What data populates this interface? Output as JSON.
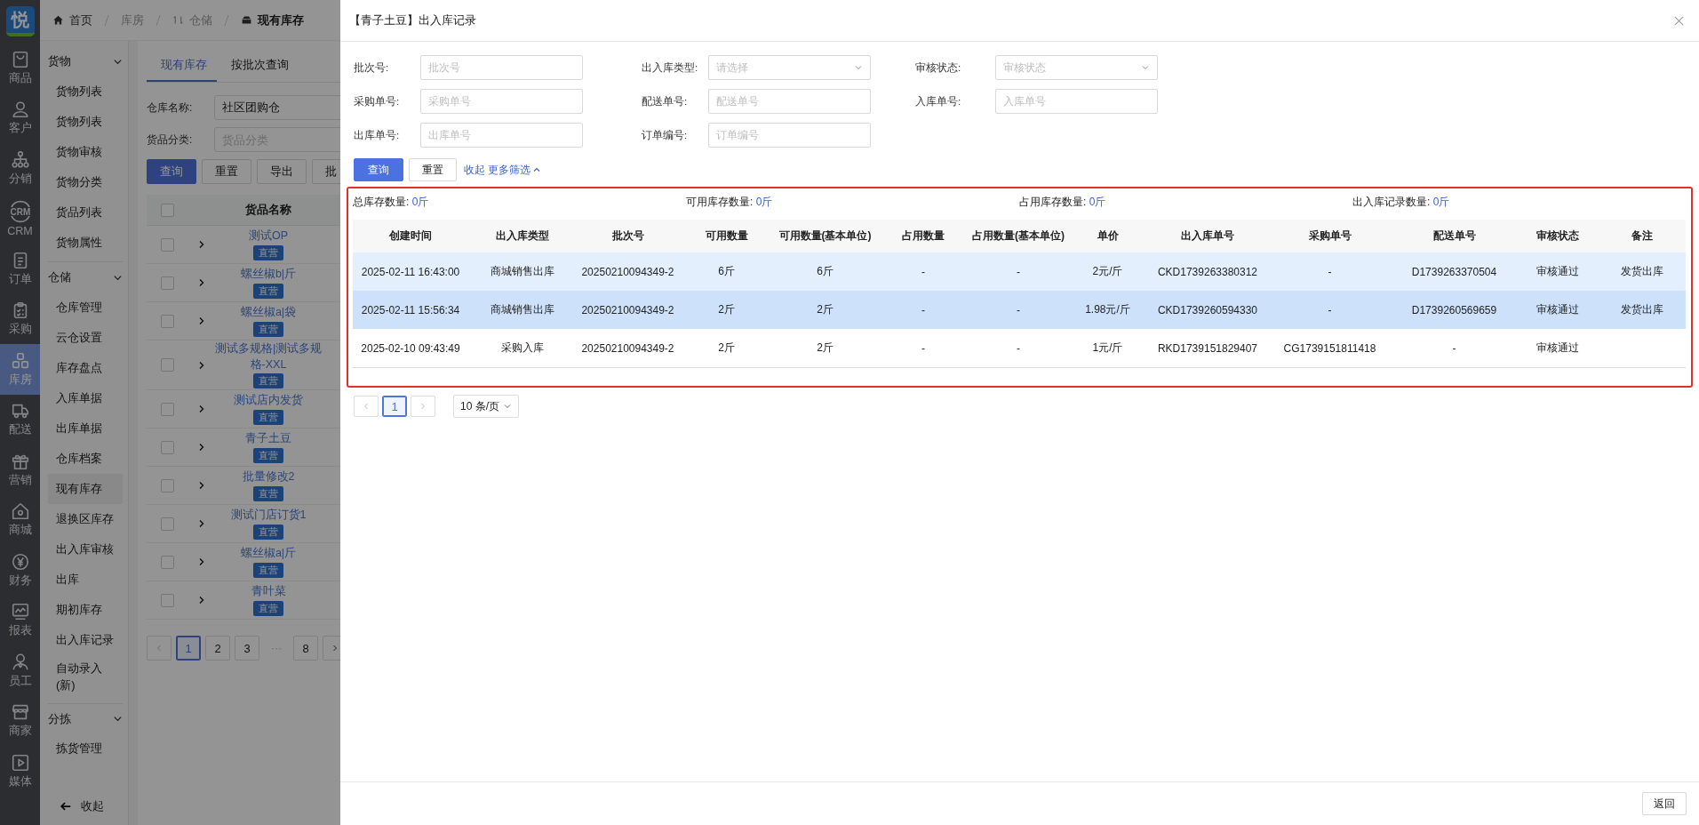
{
  "app": {
    "logo": "悦"
  },
  "nav_rail": [
    {
      "label": "商品",
      "selected": false
    },
    {
      "label": "客户",
      "selected": false
    },
    {
      "label": "分销",
      "selected": false
    },
    {
      "label": "CRM",
      "icon_text": "CRM",
      "selected": false
    },
    {
      "label": "订单",
      "selected": false
    },
    {
      "label": "采购",
      "selected": false
    },
    {
      "label": "库房",
      "selected": true
    },
    {
      "label": "配送",
      "selected": false
    },
    {
      "label": "营销",
      "selected": false
    },
    {
      "label": "商城",
      "selected": false
    },
    {
      "label": "财务",
      "selected": false
    },
    {
      "label": "报表",
      "selected": false
    },
    {
      "label": "员工",
      "selected": false
    },
    {
      "label": "商家",
      "selected": false
    },
    {
      "label": "媒体",
      "selected": false
    }
  ],
  "breadcrumb": [
    {
      "label": "首页",
      "current": false
    },
    {
      "label": "库房",
      "current": false
    },
    {
      "label": "仓储",
      "current": false
    },
    {
      "label": "现有库存",
      "current": true
    }
  ],
  "submenu": [
    {
      "label": "货物",
      "expanded": true,
      "children": [
        {
          "label": "货物列表",
          "selected": false
        },
        {
          "label": "货物列表",
          "selected": false
        },
        {
          "label": "货物审核",
          "selected": false
        },
        {
          "label": "货物分类",
          "selected": false
        },
        {
          "label": "货品列表",
          "selected": false
        },
        {
          "label": "货物属性",
          "selected": false
        }
      ]
    },
    {
      "label": "仓储",
      "expanded": true,
      "children": [
        {
          "label": "仓库管理",
          "selected": false
        },
        {
          "label": "云仓设置",
          "selected": false
        },
        {
          "label": "库存盘点",
          "selected": false
        },
        {
          "label": "入库单据",
          "selected": false
        },
        {
          "label": "出库单据",
          "selected": false
        },
        {
          "label": "仓库档案",
          "selected": false
        },
        {
          "label": "现有库存",
          "selected": true
        },
        {
          "label": "退换区库存",
          "selected": false
        },
        {
          "label": "出入库审核",
          "selected": false
        },
        {
          "label": "出库",
          "selected": false
        },
        {
          "label": "期初库存",
          "selected": false
        },
        {
          "label": "出入库记录",
          "selected": false
        },
        {
          "label": "自动录入(新)",
          "selected": false
        }
      ]
    },
    {
      "label": "分拣",
      "expanded": true,
      "children": [
        {
          "label": "拣货管理",
          "selected": false
        }
      ]
    }
  ],
  "collapse": "收起",
  "page": {
    "tabs": [
      {
        "label": "现有库存",
        "selected": true
      },
      {
        "label": "按批次查询",
        "selected": false
      }
    ],
    "filters": [
      {
        "label": "仓库名称:",
        "value": "社区团购仓"
      },
      {
        "label": "货品分类:",
        "placeholder": "货品分类"
      }
    ],
    "buttons": [
      {
        "label": "查询",
        "kind": "primary"
      },
      {
        "label": "重置",
        "kind": "default"
      },
      {
        "label": "导出",
        "kind": "default"
      },
      {
        "label": "批",
        "kind": "default"
      }
    ],
    "table": {
      "column": "货品名称",
      "all_checked": false,
      "rows": [
        {
          "name": "测试OP",
          "tag": "直营",
          "checked": false
        },
        {
          "name": "螺丝椒b|斤",
          "tag": "直营",
          "checked": false
        },
        {
          "name": "螺丝椒a|袋",
          "tag": "直营",
          "checked": false
        },
        {
          "name": "测试多规格|测试多规格-XXL",
          "tag": "直营",
          "checked": false
        },
        {
          "name": "测试店内发货",
          "tag": "直营",
          "checked": false
        },
        {
          "name": "青子土豆",
          "tag": "直营",
          "checked": false
        },
        {
          "name": "批量修改2",
          "tag": "直营",
          "checked": false
        },
        {
          "name": "测试门店订货1",
          "tag": "直营",
          "checked": false
        },
        {
          "name": "螺丝椒a|斤",
          "tag": "直营",
          "checked": false
        },
        {
          "name": "青叶菜",
          "tag": "直营",
          "checked": false
        }
      ]
    },
    "pagination": [
      {
        "label": "1",
        "kind": "page",
        "selected": true
      },
      {
        "label": "2",
        "kind": "page",
        "selected": false
      },
      {
        "label": "3",
        "kind": "page",
        "selected": false
      },
      {
        "label": "···",
        "kind": "ellipsis"
      },
      {
        "label": "8",
        "kind": "page",
        "selected": false
      }
    ]
  },
  "dialog": {
    "title": "【青子土豆】出入库记录",
    "filters": [
      {
        "label": "批次号:",
        "placeholder": "批次号",
        "kind": "input"
      },
      {
        "label": "出入库类型:",
        "placeholder": "请选择",
        "kind": "select"
      },
      {
        "label": "审核状态:",
        "placeholder": "审核状态",
        "kind": "select"
      },
      {
        "label": "采购单号:",
        "placeholder": "采购单号",
        "kind": "input"
      },
      {
        "label": "配送单号:",
        "placeholder": "配送单号",
        "kind": "input"
      },
      {
        "label": "入库单号:",
        "placeholder": "入库单号",
        "kind": "input"
      },
      {
        "label": "出库单号:",
        "placeholder": "出库单号",
        "kind": "input"
      },
      {
        "label": "订单编号:",
        "placeholder": "订单编号",
        "kind": "input"
      }
    ],
    "buttons": [
      {
        "label": "查询",
        "kind": "primary"
      },
      {
        "label": "重置",
        "kind": "default"
      }
    ],
    "toggle_link": "收起 更多筛选",
    "summary": [
      {
        "label": "总库存数量:",
        "value": "0斤"
      },
      {
        "label": "可用库存数量:",
        "value": "0斤"
      },
      {
        "label": "占用库存数量:",
        "value": "0斤"
      },
      {
        "label": "出入库记录数量:",
        "value": "0斤"
      }
    ],
    "table": {
      "columns": [
        "创建时间",
        "出入库类型",
        "批次号",
        "可用数量",
        "可用数量(基本单位)",
        "占用数量",
        "占用数量(基本单位)",
        "单价",
        "出入库单号",
        "采购单号",
        "配送单号",
        "审核状态",
        "备注"
      ],
      "rows": [
        {
          "hovered": true,
          "selected": false,
          "cells": [
            "2025-02-11 16:43:00",
            "商城销售出库",
            "20250210094349-2",
            "6斤",
            "6斤",
            "-",
            "-",
            "2元/斤",
            "CKD1739263380312",
            "-",
            "D1739263370504",
            "审核通过",
            "发货出库"
          ]
        },
        {
          "hovered": false,
          "selected": true,
          "cells": [
            "2025-02-11 15:56:34",
            "商城销售出库",
            "20250210094349-2",
            "2斤",
            "2斤",
            "-",
            "-",
            "1.98元/斤",
            "CKD1739260594330",
            "-",
            "D1739260569659",
            "审核通过",
            "发货出库"
          ]
        },
        {
          "hovered": false,
          "selected": false,
          "cells": [
            "2025-02-10 09:43:49",
            "采购入库",
            "20250210094349-2",
            "2斤",
            "2斤",
            "-",
            "-",
            "1元/斤",
            "RKD1739151829407",
            "CG1739151811418",
            "-",
            "审核通过"
          ]
        }
      ]
    },
    "pagination": {
      "pages": [
        {
          "label": "1",
          "selected": true
        }
      ],
      "page_size": "10 条/页"
    },
    "footer_button": "返回"
  }
}
